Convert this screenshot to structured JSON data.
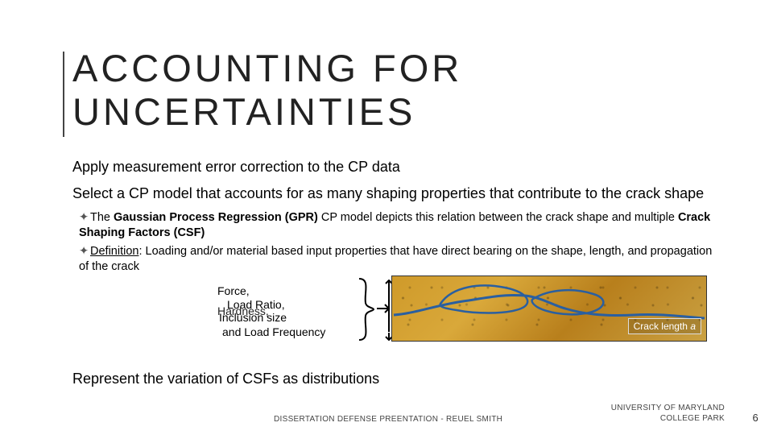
{
  "title": {
    "line1": "ACCOUNTING FOR",
    "line2": "UNCERTAINTIES"
  },
  "para1": "Apply measurement error correction to the CP data",
  "para2": "Select a CP model that accounts for as many shaping properties that contribute to the crack shape",
  "bullet1": {
    "pre": "The ",
    "b1": "Gaussian Process Regression (GPR)",
    "mid": " CP model depicts this relation between the crack shape and multiple ",
    "b2": "Crack Shaping Factors (CSF)"
  },
  "bullet2": {
    "def": "Definition",
    "rest": ": Loading and/or material based input properties that have direct bearing on the shape, length, and propagation of the crack"
  },
  "csf": {
    "t1": "Force,",
    "t2a": "Load Ratio,",
    "t2b": "Hardness, ",
    "t2c": "Inclusion size",
    "t3": "and Load Frequency"
  },
  "crack_label_pre": "Crack length ",
  "crack_label_var": "a",
  "para3": "Represent the variation of CSFs as distributions",
  "footer": {
    "left": "DISSERTATION DEFENSE PREENTATION - REUEL SMITH",
    "r1": "UNIVERSITY OF MARYLAND",
    "r2": "COLLEGE PARK",
    "page": "6"
  }
}
